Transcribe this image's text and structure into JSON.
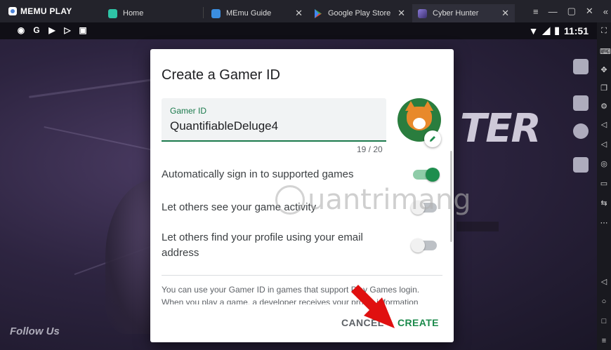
{
  "app": {
    "brand": "MEMU PLAY"
  },
  "tabs": [
    {
      "label": "Home",
      "color": "#2ec4a6"
    },
    {
      "label": "MEmu Guide",
      "color": "#3b8ee0"
    },
    {
      "label": "Google Play Store",
      "color": "#34a853"
    },
    {
      "label": "Cyber Hunter",
      "color": "#6a5acd"
    }
  ],
  "statusbar": {
    "time": "11:51"
  },
  "game": {
    "logo_text": "TER",
    "follow_label": "Follow Us"
  },
  "dialog": {
    "title": "Create a Gamer ID",
    "field_label": "Gamer ID",
    "field_value": "QuantifiableDeluge4",
    "char_counter": "19 / 20",
    "options": [
      {
        "label": "Automatically sign in to supported games",
        "enabled": true
      },
      {
        "label": "Let others see your game activity",
        "enabled": false
      },
      {
        "label": "Let others find your profile using your email address",
        "enabled": false
      }
    ],
    "info_text": "You can use your Gamer ID in games that support Play Games login. When you play a game, a developer receives your profile information",
    "cancel_label": "CANCEL",
    "create_label": "CREATE"
  },
  "watermark": "uantrimang",
  "colors": {
    "accent": "#1b8a4b",
    "arrow": "#e01010"
  }
}
